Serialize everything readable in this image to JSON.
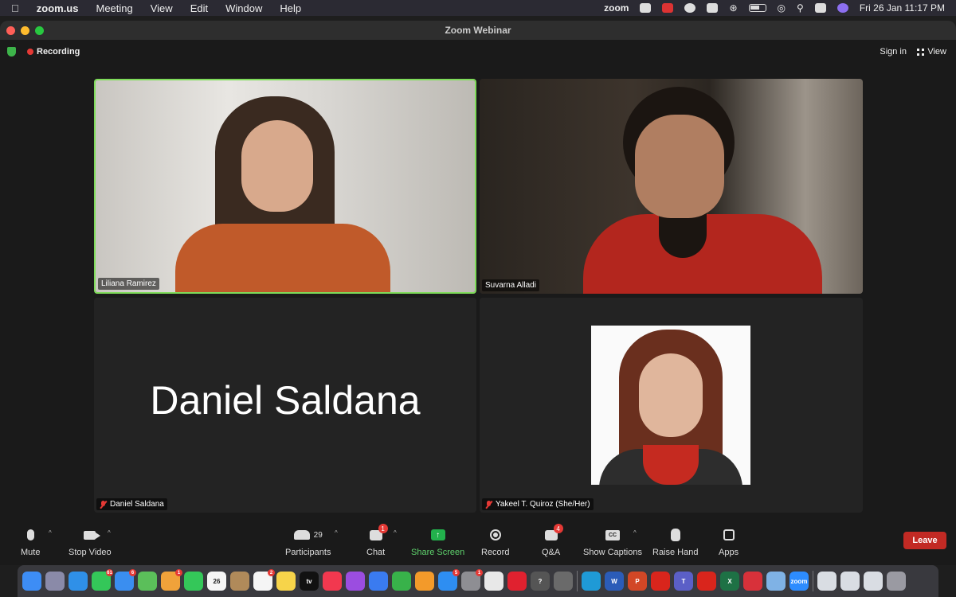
{
  "menubar": {
    "app_name": "zoom.us",
    "menus": [
      "Meeting",
      "View",
      "Edit",
      "Window",
      "Help"
    ],
    "status_zoom": "zoom",
    "datetime": "Fri 26 Jan  11:17 PM"
  },
  "window": {
    "title": "Zoom Webinar",
    "recording_label": "Recording",
    "sign_in_label": "Sign in",
    "view_label": "View"
  },
  "participants": [
    {
      "name": "Liliana Ramirez"
    },
    {
      "name": "Suvarna Alladi"
    },
    {
      "name": "Daniel Saldana",
      "big_name": "Daniel Saldana"
    },
    {
      "name": "Yakeel T. Quiroz (She/Her)"
    }
  ],
  "controls": {
    "mute": "Mute",
    "stop_video": "Stop Video",
    "participants": "Participants",
    "participants_count": "29",
    "chat": "Chat",
    "chat_badge": "1",
    "share_screen": "Share Screen",
    "record": "Record",
    "qa": "Q&A",
    "qa_badge": "4",
    "show_captions": "Show Captions",
    "cc": "CC",
    "raise_hand": "Raise Hand",
    "apps": "Apps",
    "leave": "Leave"
  },
  "dock": {
    "apps": [
      {
        "name": "finder",
        "color": "#3d8df5",
        "badge": ""
      },
      {
        "name": "launchpad",
        "color": "#8a8aa8",
        "badge": ""
      },
      {
        "name": "safari",
        "color": "#2f90e8",
        "badge": ""
      },
      {
        "name": "messages",
        "color": "#34c759",
        "badge": "61"
      },
      {
        "name": "mail",
        "color": "#3a8ef0",
        "badge": "6"
      },
      {
        "name": "maps",
        "color": "#5bbf5a",
        "badge": ""
      },
      {
        "name": "photos",
        "color": "#f0a23a",
        "badge": "1"
      },
      {
        "name": "facetime",
        "color": "#34c759",
        "badge": ""
      },
      {
        "name": "calendar",
        "color": "#f5f5f5",
        "label": "26",
        "badge": ""
      },
      {
        "name": "contacts",
        "color": "#b08a5a",
        "badge": ""
      },
      {
        "name": "reminders",
        "color": "#f5f5f5",
        "badge": "2"
      },
      {
        "name": "notes",
        "color": "#f7d44a",
        "badge": ""
      },
      {
        "name": "apple-tv",
        "color": "#111111",
        "label": "tv",
        "badge": ""
      },
      {
        "name": "music",
        "color": "#f2384f",
        "badge": ""
      },
      {
        "name": "podcasts",
        "color": "#9b4de0",
        "badge": ""
      },
      {
        "name": "keynote",
        "color": "#3a7bf0",
        "badge": ""
      },
      {
        "name": "numbers",
        "color": "#38b24a",
        "badge": ""
      },
      {
        "name": "pages",
        "color": "#f39a2a",
        "badge": ""
      },
      {
        "name": "app-store",
        "color": "#2e8ef2",
        "badge": "5"
      },
      {
        "name": "system-settings",
        "color": "#8e8e93",
        "badge": "1"
      },
      {
        "name": "chrome",
        "color": "#e8e8e8",
        "badge": ""
      },
      {
        "name": "opera",
        "color": "#e0212f",
        "badge": ""
      },
      {
        "name": "help",
        "color": "#555555",
        "label": "?",
        "badge": ""
      },
      {
        "name": "keychain",
        "color": "#6a6a6a",
        "badge": ""
      },
      {
        "name": "edge",
        "color": "#1f9ad6",
        "badge": ""
      },
      {
        "name": "word",
        "color": "#2b5cb8",
        "label": "W",
        "badge": ""
      },
      {
        "name": "powerpoint",
        "color": "#d24726",
        "label": "P",
        "badge": ""
      },
      {
        "name": "acrobat",
        "color": "#d9251c",
        "badge": ""
      },
      {
        "name": "teams",
        "color": "#5b5fc7",
        "label": "T",
        "badge": ""
      },
      {
        "name": "acrobat-reader",
        "color": "#d9251c",
        "badge": ""
      },
      {
        "name": "excel",
        "color": "#1e7145",
        "label": "X",
        "badge": ""
      },
      {
        "name": "expressvpn",
        "color": "#d8313a",
        "badge": ""
      },
      {
        "name": "preview",
        "color": "#7fb2e5",
        "badge": ""
      },
      {
        "name": "zoom",
        "color": "#2d8cff",
        "label": "zoom",
        "badge": ""
      }
    ]
  }
}
